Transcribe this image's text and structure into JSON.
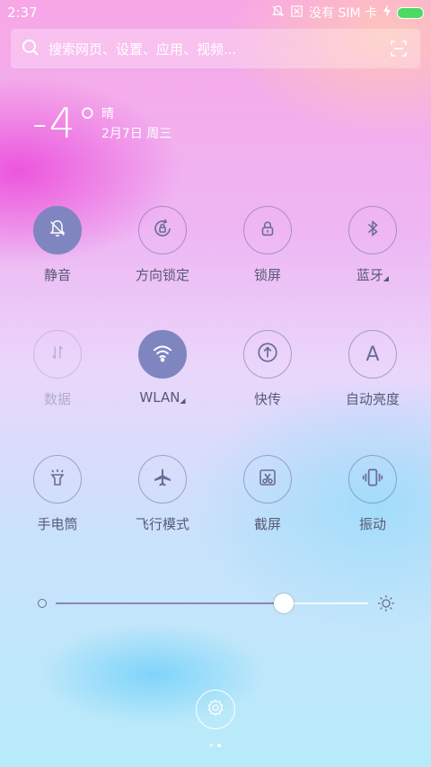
{
  "status_bar": {
    "time": "2:37",
    "carrier": "没有 SIM 卡",
    "battery_color": "#4cd964"
  },
  "search": {
    "placeholder": "搜索网页、设置、应用、视频..."
  },
  "weather": {
    "temperature": "-4°",
    "condition": "晴",
    "date": "2月7日 周三"
  },
  "toggles": [
    {
      "label": "静音",
      "icon": "bell-off-icon",
      "state": "active"
    },
    {
      "label": "方向锁定",
      "icon": "rotation-lock-icon",
      "state": "normal"
    },
    {
      "label": "锁屏",
      "icon": "lock-icon",
      "state": "normal"
    },
    {
      "label": "蓝牙",
      "icon": "bluetooth-icon",
      "state": "normal",
      "has_menu": true
    },
    {
      "label": "数据",
      "icon": "data-icon",
      "state": "disabled"
    },
    {
      "label": "WLAN",
      "icon": "wifi-icon",
      "state": "active",
      "has_menu": true
    },
    {
      "label": "快传",
      "icon": "share-upload-icon",
      "state": "normal"
    },
    {
      "label": "自动亮度",
      "icon": "auto-brightness-icon",
      "state": "normal",
      "glyph": "A"
    },
    {
      "label": "手电筒",
      "icon": "flashlight-icon",
      "state": "normal"
    },
    {
      "label": "飞行模式",
      "icon": "airplane-icon",
      "state": "normal"
    },
    {
      "label": "截屏",
      "icon": "screenshot-icon",
      "state": "normal"
    },
    {
      "label": "振动",
      "icon": "vibrate-icon",
      "state": "normal"
    }
  ],
  "brightness": {
    "level": 0.73
  },
  "colors": {
    "active_toggle": "#7f86bf",
    "label_text": "#585a75"
  },
  "page_indicator": {
    "count": 2,
    "active_index": 1
  }
}
